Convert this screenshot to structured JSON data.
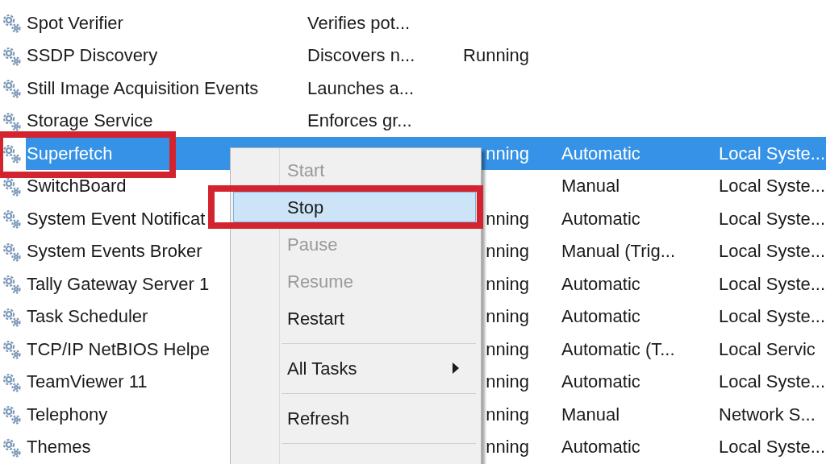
{
  "services": [
    {
      "name": "Spot Verifier",
      "description": "Verifies pot...",
      "selected": false
    },
    {
      "name": "SSDP Discovery",
      "description": "Discovers n...",
      "status": "Running",
      "selected": false
    },
    {
      "name": "Still Image Acquisition Events",
      "description": "Launches a...",
      "selected": false
    },
    {
      "name": "Storage Service",
      "description": "Enforces gr...",
      "selected": false
    },
    {
      "name": "Superfetch",
      "status": "nning",
      "startup_type": "Automatic",
      "log_on_as": "Local Syste...",
      "selected": true
    },
    {
      "name": "SwitchBoard",
      "startup_type": "Manual",
      "log_on_as": "Local Syste...",
      "selected": false
    },
    {
      "name": "System Event Notificat",
      "status": "nning",
      "startup_type": "Automatic",
      "log_on_as": "Local Syste...",
      "selected": false
    },
    {
      "name": "System Events Broker",
      "status": "nning",
      "startup_type": "Manual (Trig...",
      "log_on_as": "Local Syste...",
      "selected": false
    },
    {
      "name": "Tally Gateway Server 1",
      "status": "nning",
      "startup_type": "Automatic",
      "log_on_as": "Local Syste...",
      "selected": false
    },
    {
      "name": "Task Scheduler",
      "status": "nning",
      "startup_type": "Automatic",
      "log_on_as": "Local Syste...",
      "selected": false
    },
    {
      "name": "TCP/IP NetBIOS Helpe",
      "status": "nning",
      "startup_type": "Automatic (T...",
      "log_on_as": "Local Servic",
      "selected": false
    },
    {
      "name": "TeamViewer 11",
      "status": "nning",
      "startup_type": "Automatic",
      "log_on_as": "Local Syste...",
      "selected": false
    },
    {
      "name": "Telephony",
      "status": "nning",
      "startup_type": "Manual",
      "log_on_as": "Network S...",
      "selected": false
    },
    {
      "name": "Themes",
      "status": "nning",
      "startup_type": "Automatic",
      "log_on_as": "Local Syste...",
      "selected": false
    }
  ],
  "context_menu": {
    "items": [
      {
        "kind": "item",
        "label": "Start",
        "disabled": true,
        "highlighted": false
      },
      {
        "kind": "item",
        "label": "Stop",
        "disabled": false,
        "highlighted": true
      },
      {
        "kind": "item",
        "label": "Pause",
        "disabled": true,
        "highlighted": false
      },
      {
        "kind": "item",
        "label": "Resume",
        "disabled": true,
        "highlighted": false
      },
      {
        "kind": "item",
        "label": "Restart",
        "disabled": false,
        "highlighted": false
      },
      {
        "kind": "separator"
      },
      {
        "kind": "submenu",
        "label": "All Tasks",
        "disabled": false,
        "highlighted": false
      },
      {
        "kind": "separator"
      },
      {
        "kind": "item",
        "label": "Refresh",
        "disabled": false,
        "highlighted": false
      },
      {
        "kind": "separator"
      }
    ]
  }
}
